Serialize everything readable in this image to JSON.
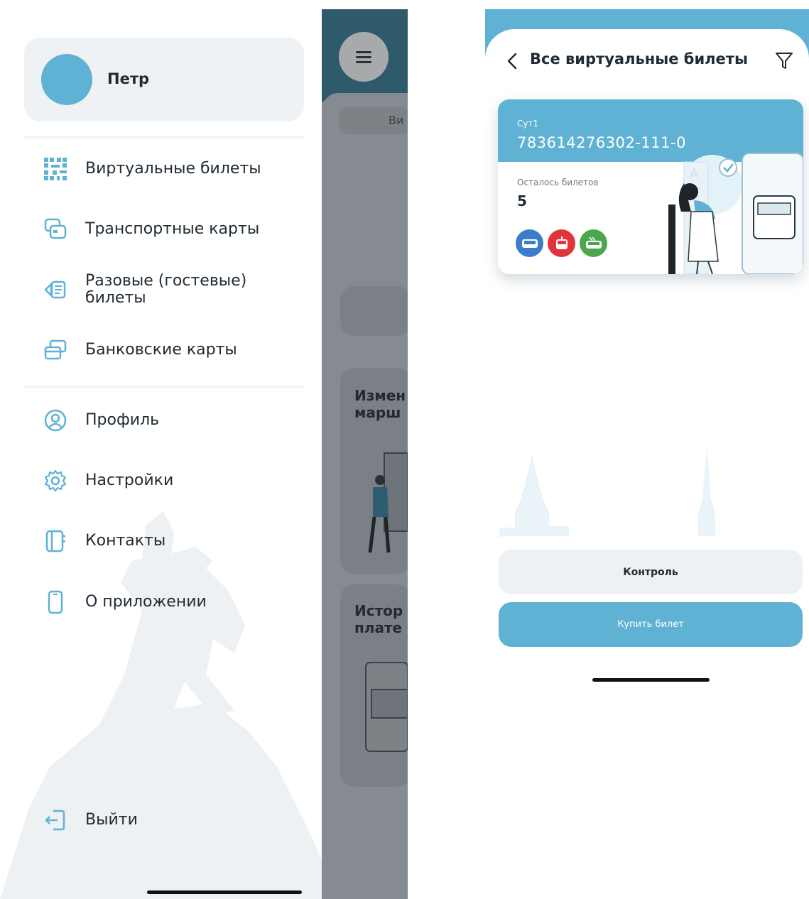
{
  "drawer": {
    "user_name": "Петр",
    "menu_primary": [
      {
        "label": "Виртуальные билеты",
        "icon": "qr-code-icon"
      },
      {
        "label": "Транспортные карты",
        "icon": "transport-card-icon"
      },
      {
        "label": "Разовые (гостевые) билеты",
        "icon": "guest-ticket-icon"
      },
      {
        "label": "Банковские карты",
        "icon": "bank-cards-icon"
      }
    ],
    "menu_secondary": [
      {
        "label": "Профиль",
        "icon": "profile-icon"
      },
      {
        "label": "Настройки",
        "icon": "gear-icon"
      },
      {
        "label": "Контакты",
        "icon": "contacts-book-icon"
      },
      {
        "label": "О приложении",
        "icon": "phone-icon"
      }
    ],
    "logout_label": "Выйти",
    "accent_color": "#5fb2d3"
  },
  "background_screen": {
    "pill_text": "Ви",
    "card1_title": "Измен\nмарш",
    "card2_title": "Истор\nплате"
  },
  "tickets_screen": {
    "title": "Все виртуальные билеты",
    "ticket": {
      "type": "Сут1",
      "number": "783614276302-111-0",
      "remaining_label": "Осталось билетов",
      "remaining_value": "5",
      "modes": [
        {
          "name": "bus-icon",
          "color": "#3d7cc9"
        },
        {
          "name": "tram-icon",
          "color": "#e0363b"
        },
        {
          "name": "trolleybus-icon",
          "color": "#4ca64c"
        }
      ]
    },
    "control_button": "Контроль",
    "buy_button": "Купить билет"
  }
}
